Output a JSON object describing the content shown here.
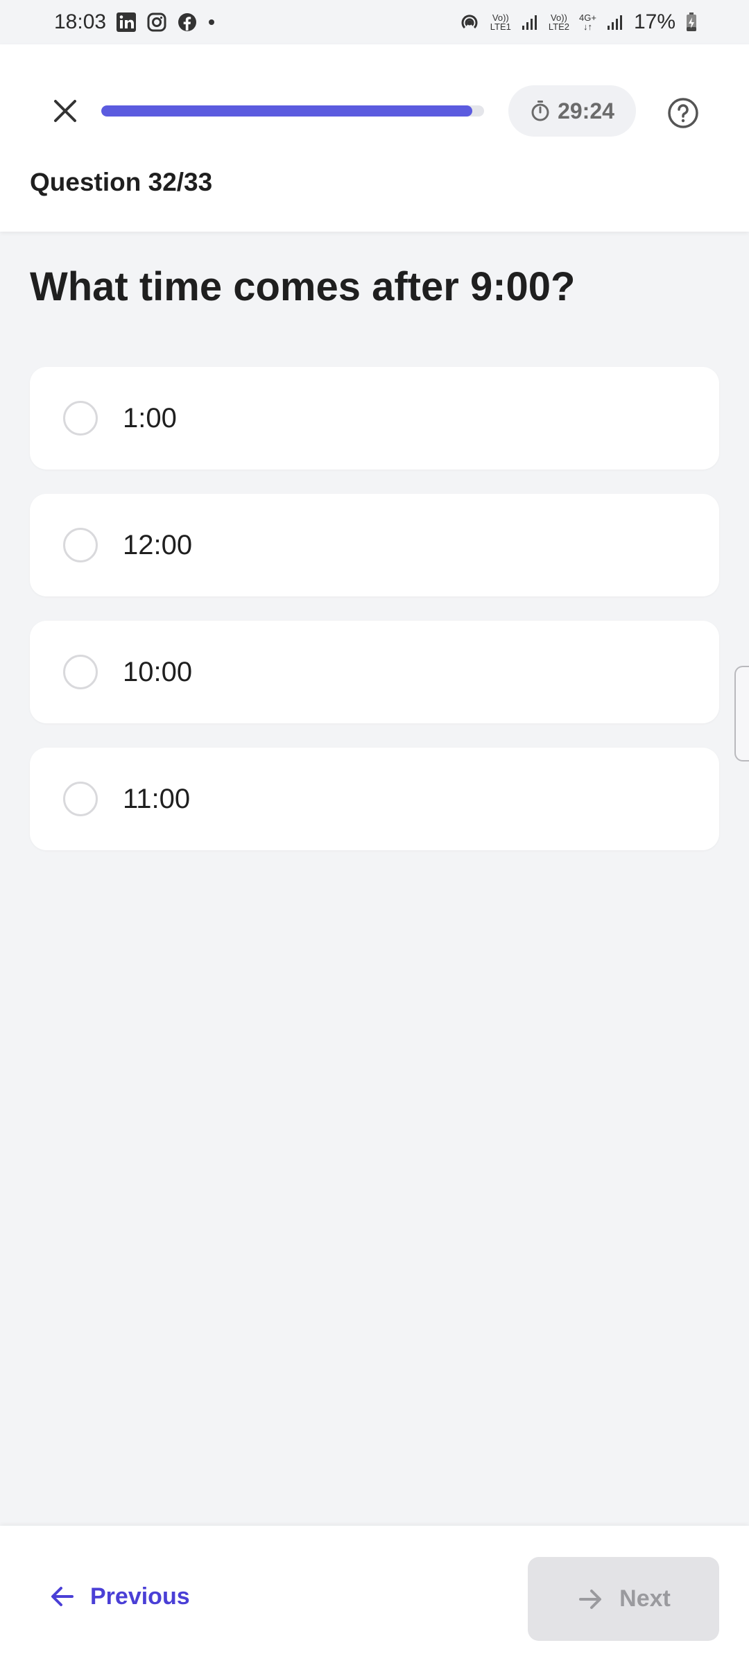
{
  "status_bar": {
    "time": "18:03",
    "battery": "17%",
    "sim1_label": "LTE1",
    "sim2_label": "LTE2",
    "volte": "Vo))",
    "network": "4G+"
  },
  "header": {
    "progress_fraction": 0.97,
    "timer": "29:24",
    "question_counter": "Question 32/33",
    "accent_color": "#5b5bdf"
  },
  "question": {
    "title": "What time comes after 9:00?",
    "options": [
      {
        "label": "1:00"
      },
      {
        "label": "12:00"
      },
      {
        "label": "10:00"
      },
      {
        "label": "11:00"
      }
    ]
  },
  "footer": {
    "previous_label": "Previous",
    "next_label": "Next"
  }
}
